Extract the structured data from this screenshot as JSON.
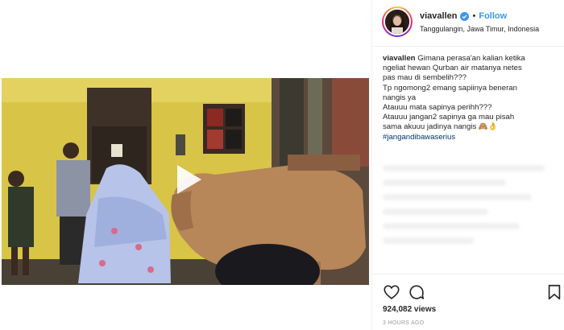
{
  "post": {
    "username": "viavallen",
    "follow_label": "Follow",
    "separator": "•",
    "location": "Tanggulangin, Jawa Timur, Indonesia",
    "caption": {
      "username": "viavallen",
      "lines": [
        "Gimana perasa'an kalian ketika",
        "ngeliat hewan Qurban air matanya netes",
        "pas mau di sembelih???",
        "Tp ngomong2 emang sapiinya beneran",
        "nangis ya",
        "Atauuu mata sapinya perihh???",
        "Atauuu jangan2 sapinya ga mau pisah",
        "sama akuuu jadinya nangis 🙈👌"
      ],
      "hashtag": "#jangandibawaserius"
    },
    "views": "924,082 views",
    "timestamp": "3 HOURS AGO"
  },
  "icons": {
    "play": "play-icon",
    "heart": "heart-icon",
    "comment": "comment-icon",
    "bookmark": "bookmark-icon",
    "verified": "verified-badge-icon"
  },
  "colors": {
    "follow": "#3897f0",
    "verified": "#3897f0",
    "hashtag": "#003569",
    "timestamp": "#999999"
  }
}
